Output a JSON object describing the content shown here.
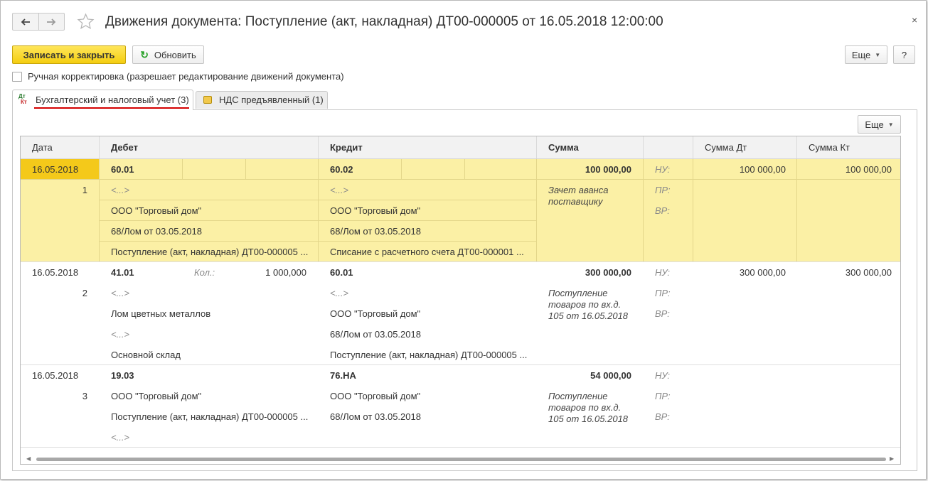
{
  "window": {
    "title": "Движения документа: Поступление (акт, накладная) ДТ00-000005 от 16.05.2018 12:00:00",
    "close": "×"
  },
  "toolbar": {
    "save_close": "Записать и закрыть",
    "refresh": "Обновить",
    "more": "Еще",
    "help": "?"
  },
  "manual_edit": {
    "label": "Ручная корректировка (разрешает редактирование движений документа)",
    "checked": false
  },
  "tabs": [
    {
      "icon_top": "Дт",
      "icon_bottom": "Кт",
      "label": "Бухгалтерский и налоговый учет (3)",
      "active": true
    },
    {
      "label": "НДС предъявленный (1)",
      "active": false
    }
  ],
  "panel": {
    "more": "Еще"
  },
  "columns": {
    "date": "Дата",
    "debit": "Дебет",
    "credit": "Кредит",
    "sum": "Сумма",
    "sum_dt": "Сумма Дт",
    "sum_kt": "Сумма Кт"
  },
  "rows": [
    {
      "date": "16.05.2018",
      "num": "1",
      "debit_account": "60.01",
      "debit_qty_label": "",
      "debit_qty": "",
      "debit_sub": [
        "<...>",
        "ООО \"Торговый дом\"",
        "68/Лом от 03.05.2018",
        "Поступление (акт, накладная) ДТ00-000005 ..."
      ],
      "credit_account": "60.02",
      "credit_sub": [
        "<...>",
        "ООО \"Торговый дом\"",
        "68/Лом от 03.05.2018",
        "Списание с расчетного счета ДТ00-000001 ..."
      ],
      "sum": "100 000,00",
      "content": "Зачет аванса поставщику",
      "nu": "НУ:",
      "pr": "ПР:",
      "vr": "ВР:",
      "sum_dt": "100 000,00",
      "sum_kt": "100 000,00"
    },
    {
      "date": "16.05.2018",
      "num": "2",
      "debit_account": "41.01",
      "debit_qty_label": "Кол.:",
      "debit_qty": "1 000,000",
      "debit_sub": [
        "<...>",
        "Лом цветных металлов",
        "<...>",
        "Основной склад"
      ],
      "credit_account": "60.01",
      "credit_sub": [
        "<...>",
        "ООО \"Торговый дом\"",
        "68/Лом от 03.05.2018",
        "Поступление (акт, накладная) ДТ00-000005 ..."
      ],
      "sum": "300 000,00",
      "content": "Поступление товаров по вх.д. 105 от 16.05.2018",
      "nu": "НУ:",
      "pr": "ПР:",
      "vr": "ВР:",
      "sum_dt": "300 000,00",
      "sum_kt": "300 000,00"
    },
    {
      "date": "16.05.2018",
      "num": "3",
      "debit_account": "19.03",
      "debit_sub": [
        "ООО \"Торговый дом\"",
        "Поступление (акт, накладная) ДТ00-000005 ...",
        "<...>"
      ],
      "credit_account": "76.НА",
      "credit_sub": [
        "ООО \"Торговый дом\"",
        "68/Лом от 03.05.2018"
      ],
      "sum": "54 000,00",
      "content": "Поступление товаров по вх.д. 105 от 16.05.2018",
      "nu": "НУ:",
      "pr": "ПР:",
      "vr": "ВР:",
      "sum_dt": "",
      "sum_kt": ""
    }
  ],
  "colors": {
    "accent_yellow": "#f4cd10",
    "selected_row": "#fbf0a5",
    "tab_underline": "#d40000"
  }
}
